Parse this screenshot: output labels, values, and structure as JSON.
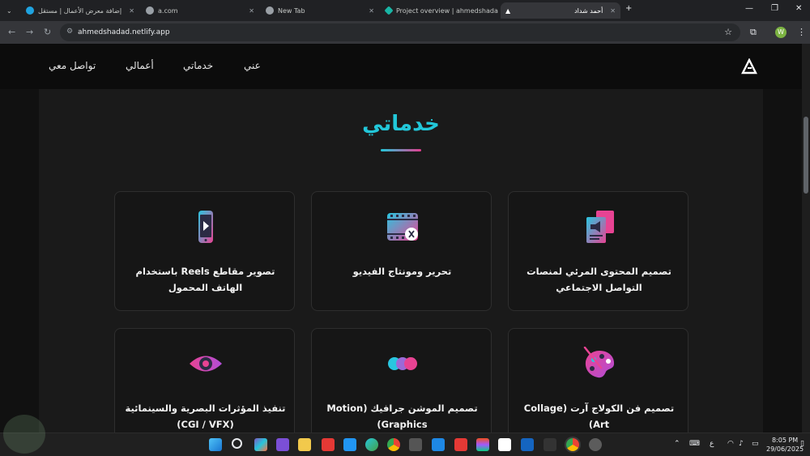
{
  "browser": {
    "tabs": [
      {
        "label": "إضافة معرض الأعمال | مستقل"
      },
      {
        "label": "a.com"
      },
      {
        "label": "New Tab"
      },
      {
        "label": "Project overview | ahmedshada"
      },
      {
        "label": "أحمد شداد"
      }
    ],
    "url": "ahmedshadad.netlify.app",
    "profile_initial": "W"
  },
  "nav": {
    "items": [
      "تواصل معي",
      "أعمالي",
      "خدماتي",
      "عني"
    ]
  },
  "services": {
    "title": "خدماتي",
    "cards": [
      {
        "label": "تصوير مقاطع Reels باستخدام الهاتف المحمول",
        "icon": "smartphone-play-icon"
      },
      {
        "label": "تحرير ومونتاج الفيديو",
        "icon": "film-scissors-icon"
      },
      {
        "label": "تصميم المحتوى المرئي لمنصات التواصل الاجتماعي",
        "icon": "megaphone-document-icon"
      },
      {
        "label": "تنفيذ المؤثرات البصرية والسينمائية (CGI / VFX)",
        "icon": "eye-icon"
      },
      {
        "label": "تصميم الموشن جرافيك (Motion Graphics)",
        "icon": "motion-circles-icon"
      },
      {
        "label": "تصميم فن الكولاج آرت (Collage Art)",
        "icon": "palette-brush-icon"
      }
    ]
  },
  "taskbar": {
    "lang": "ع",
    "time": "8:05 PM",
    "date": "29/06/2025"
  },
  "colors": {
    "accent": "#22c7d9",
    "accent2": "#e43d8f"
  }
}
